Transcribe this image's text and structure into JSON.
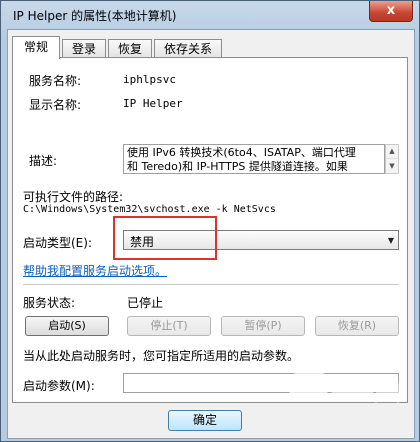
{
  "window": {
    "title": "IP Helper 的属性(本地计算机)",
    "close_glyph": "x"
  },
  "tabs": [
    {
      "label": "常规"
    },
    {
      "label": "登录"
    },
    {
      "label": "恢复"
    },
    {
      "label": "依存关系"
    }
  ],
  "general": {
    "service_name_label": "服务名称:",
    "service_name": "iphlpsvc",
    "display_name_label": "显示名称:",
    "display_name": "IP Helper",
    "description_label": "描述:",
    "description_line1": "使用 IPv6 转换技术(6to4、ISATAP、端口代理",
    "description_line2": "和 Teredo)和 IP-HTTPS 提供隧道连接。如果",
    "exe_path_label": "可执行文件的路径:",
    "exe_path": "C:\\Windows\\System32\\svchost.exe -k NetSvcs",
    "startup_type_label": "启动类型(E):",
    "startup_type": "禁用",
    "help_link": "帮助我配置服务启动选项。",
    "status_label": "服务状态:",
    "status_value": "已停止",
    "buttons": {
      "start": "启动(S)",
      "stop": "停止(T)",
      "pause": "暂停(P)",
      "resume": "恢复(R)"
    },
    "hint": "当从此处启动服务时，您可指定所适用的启动参数。",
    "start_params_label": "启动参数(M):",
    "start_params_value": ""
  },
  "footer": {
    "ok": "确定"
  },
  "colors": {
    "highlight_box": "#e03030",
    "link": "#0b5fc2"
  }
}
